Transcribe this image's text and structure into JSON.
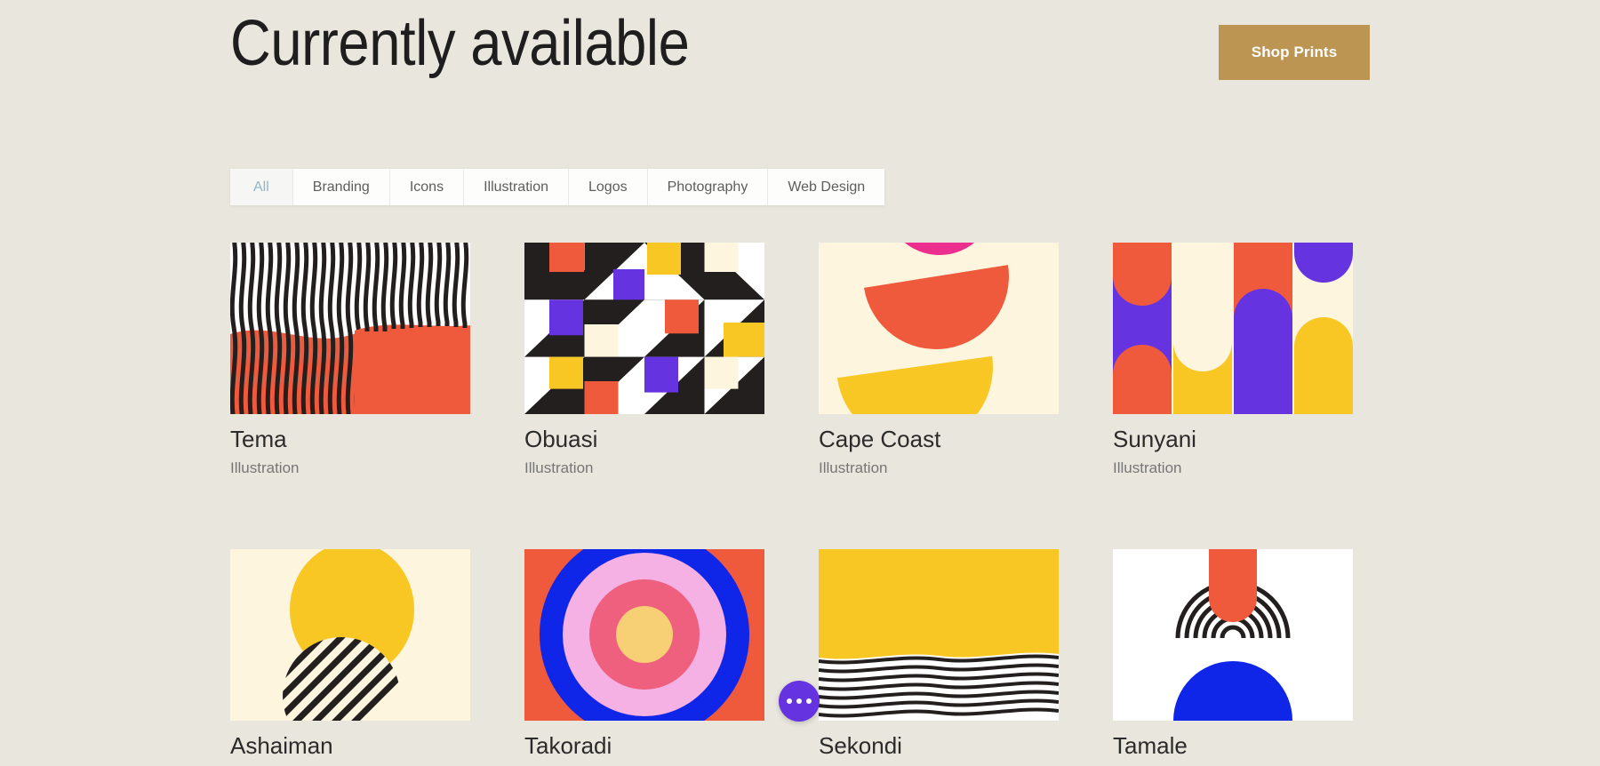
{
  "header": {
    "title": "Currently available",
    "shop_button_label": "Shop Prints",
    "shop_button_color": "#bd9553"
  },
  "filters": {
    "active": "All",
    "active_color": "#8fb6cd",
    "tabs": [
      {
        "label": "All"
      },
      {
        "label": "Branding"
      },
      {
        "label": "Icons"
      },
      {
        "label": "Illustration"
      },
      {
        "label": "Logos"
      },
      {
        "label": "Photography"
      },
      {
        "label": "Web Design"
      }
    ]
  },
  "gallery": {
    "items": [
      {
        "title": "Tema",
        "category": "Illustration",
        "art": "wavy-stripes-orange"
      },
      {
        "title": "Obuasi",
        "category": "Illustration",
        "art": "bauhaus-grid"
      },
      {
        "title": "Cape Coast",
        "category": "Illustration",
        "art": "stacked-half-circles"
      },
      {
        "title": "Sunyani",
        "category": "Illustration",
        "art": "arch-columns"
      },
      {
        "title": "Ashaiman",
        "category": "",
        "art": "sun-striped-circle"
      },
      {
        "title": "Takoradi",
        "category": "",
        "art": "concentric-target"
      },
      {
        "title": "Sekondi",
        "category": "",
        "art": "yellow-wave-lines"
      },
      {
        "title": "Tamale",
        "category": "",
        "art": "arches-and-dome"
      }
    ]
  },
  "fab": {
    "icon": "more-horizontal-icon",
    "color": "#6633e0"
  },
  "palette": {
    "background": "#e9e6dd",
    "orange": "#f05a3c",
    "yellow": "#f9c724",
    "purple": "#6633e0",
    "cream": "#fdf5dd",
    "pink": "#ec2f8e",
    "blue": "#0f26e8",
    "rose": "#ef5f7e",
    "lightpink": "#f5b0e4",
    "black": "#231f1e",
    "white": "#ffffff"
  }
}
